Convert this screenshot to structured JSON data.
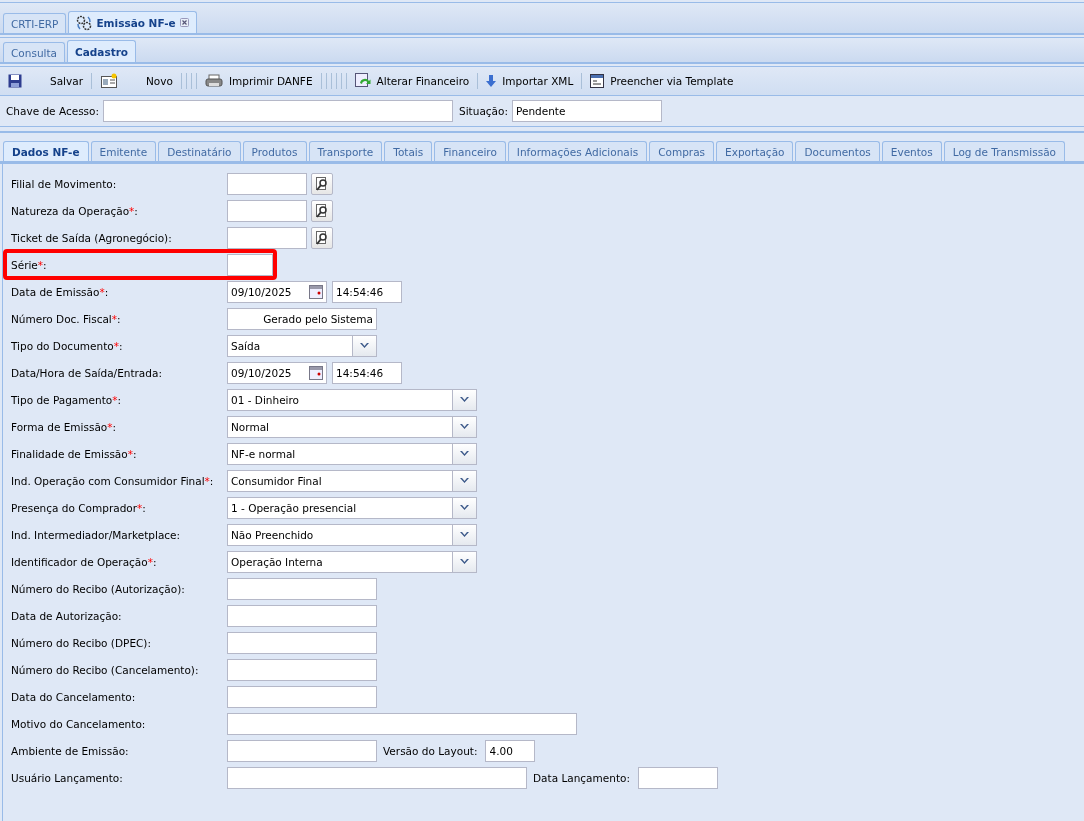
{
  "app_tabs": [
    {
      "label": "CRTI-ERP",
      "selected": false,
      "closable": false,
      "icon": false
    },
    {
      "label": "Emissão NF-e",
      "selected": true,
      "closable": true,
      "icon": true
    }
  ],
  "mode_tabs": [
    {
      "label": "Consulta",
      "selected": false
    },
    {
      "label": "Cadastro",
      "selected": true
    }
  ],
  "toolbar": [
    {
      "kind": "save",
      "label": "Salvar"
    },
    {
      "kind": "new",
      "label": "Novo"
    },
    {
      "kind": "print",
      "label": "Imprimir DANFE"
    },
    {
      "kind": "finance",
      "label": "Alterar Financeiro"
    },
    {
      "kind": "import",
      "label": "Importar XML"
    },
    {
      "kind": "template",
      "label": "Preencher via Template"
    }
  ],
  "access_key": {
    "label": "Chave de Acesso:"
  },
  "status": {
    "label": "Situação:",
    "value": "Pendente"
  },
  "section_tabs": [
    {
      "label": "Dados NF-e",
      "selected": true
    },
    {
      "label": "Emitente",
      "selected": false
    },
    {
      "label": "Destinatário",
      "selected": false
    },
    {
      "label": "Produtos",
      "selected": false
    },
    {
      "label": "Transporte",
      "selected": false
    },
    {
      "label": "Totais",
      "selected": false
    },
    {
      "label": "Financeiro",
      "selected": false
    },
    {
      "label": "Informações Adicionais",
      "selected": false
    },
    {
      "label": "Compras",
      "selected": false
    },
    {
      "label": "Exportação",
      "selected": false
    },
    {
      "label": "Documentos",
      "selected": false
    },
    {
      "label": "Eventos",
      "selected": false
    },
    {
      "label": "Log de Transmissão",
      "selected": false
    }
  ],
  "fields": [
    {
      "label": "Filial de Movimento:",
      "kind": "lookup"
    },
    {
      "label": "Natureza da Operação",
      "required_mark": "*",
      "suffix": ":",
      "kind": "lookup"
    },
    {
      "label": "Ticket de Saída (Agronegócio):",
      "kind": "lookup"
    },
    {
      "label": "Série",
      "required_mark": "*",
      "suffix": ":",
      "kind": "short",
      "highlighted": true
    },
    {
      "label": "Data de Emissão",
      "required_mark": "*",
      "suffix": ":",
      "kind": "datetime",
      "value": "09/10/2025",
      "time": "14:54:46"
    },
    {
      "label": "Número Doc. Fiscal",
      "required_mark": "*",
      "suffix": ":",
      "kind": "readonly",
      "value": "Gerado pelo Sistema"
    },
    {
      "label": "Tipo do Documento",
      "required_mark": "*",
      "suffix": ":",
      "kind": "select_short",
      "value": "Saída"
    },
    {
      "label": "Data/Hora de Saída/Entrada:",
      "kind": "datetime",
      "value": "09/10/2025",
      "time": "14:54:46"
    },
    {
      "label": "Tipo de Pagamento",
      "required_mark": "*",
      "suffix": ":",
      "kind": "select",
      "value": "01 - Dinheiro"
    },
    {
      "label": "Forma de Emissão",
      "required_mark": "*",
      "suffix": ":",
      "kind": "select",
      "value": "Normal"
    },
    {
      "label": "Finalidade de Emissão",
      "required_mark": "*",
      "suffix": ":",
      "kind": "select",
      "value": "NF-e normal"
    },
    {
      "label": "Ind. Operação com Consumidor Final",
      "required_mark": "*",
      "suffix": ":",
      "kind": "select",
      "value": "Consumidor Final"
    },
    {
      "label": "Presença do Comprador",
      "required_mark": "*",
      "suffix": ":",
      "kind": "select",
      "value": "1 - Operação presencial"
    },
    {
      "label": "Ind. Intermediador/Marketplace:",
      "kind": "select",
      "value": "Não Preenchido"
    },
    {
      "label": "Identificador de Operação",
      "required_mark": "*",
      "suffix": ":",
      "kind": "select",
      "value": "Operação Interna"
    },
    {
      "label": "Número do Recibo (Autorização):",
      "kind": "text"
    },
    {
      "label": "Data de Autorização:",
      "kind": "text"
    },
    {
      "label": "Número do Recibo (DPEC):",
      "kind": "text"
    },
    {
      "label": "Número do Recibo (Cancelamento):",
      "kind": "text"
    },
    {
      "label": "Data do Cancelamento:",
      "kind": "text"
    },
    {
      "label": "Motivo do Cancelamento:",
      "kind": "wide"
    },
    {
      "label": "Ambiente de Emissão:",
      "kind": "text",
      "extra": {
        "label": "Versão do Layout:",
        "value": "4.00"
      }
    },
    {
      "label": "Usuário Lançamento:",
      "kind": "long",
      "extra": {
        "label": "Data Lançamento:"
      }
    }
  ]
}
